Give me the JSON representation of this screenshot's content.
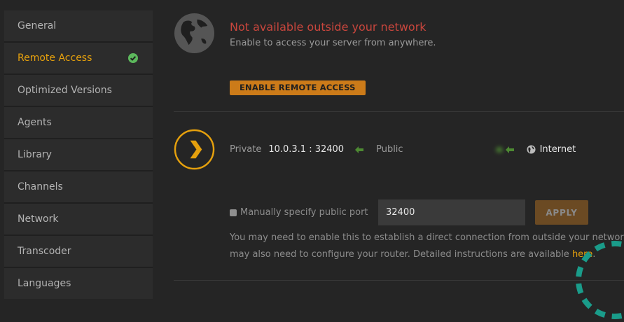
{
  "sidebar": {
    "items": [
      {
        "label": "General"
      },
      {
        "label": "Remote Access"
      },
      {
        "label": "Optimized Versions"
      },
      {
        "label": "Agents"
      },
      {
        "label": "Library"
      },
      {
        "label": "Channels"
      },
      {
        "label": "Network"
      },
      {
        "label": "Transcoder"
      },
      {
        "label": "Languages"
      }
    ],
    "active_index": 1
  },
  "status": {
    "title": "Not available outside your network",
    "subtitle": "Enable to access your server from anywhere.",
    "enable_button": "ENABLE REMOTE ACCESS"
  },
  "connection": {
    "private_label": "Private",
    "private_value": "10.0.3.1 : 32400",
    "public_label": "Public",
    "internet_label": "Internet"
  },
  "manual_port": {
    "checkbox_label": "Manually specify public port",
    "port_value": "32400",
    "apply_button": "APPLY",
    "help_text_1": "You may need to enable this to establish a direct connection from outside your network",
    "help_text_2": "may also need to configure your router. Detailed instructions are available ",
    "help_link": "here",
    "help_text_2_end": "."
  },
  "colors": {
    "accent": "#e5a00d",
    "error": "#c9463d",
    "success": "#5cb85c"
  }
}
